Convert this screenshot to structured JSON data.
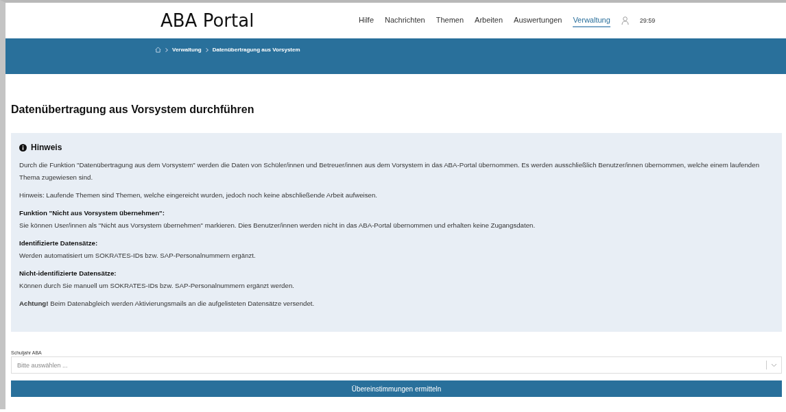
{
  "header": {
    "logo": "ABA Portal",
    "nav": [
      {
        "label": "Hilfe",
        "selected": false
      },
      {
        "label": "Nachrichten",
        "selected": false
      },
      {
        "label": "Themen",
        "selected": false
      },
      {
        "label": "Arbeiten",
        "selected": false
      },
      {
        "label": "Auswertungen",
        "selected": false
      },
      {
        "label": "Verwaltung",
        "selected": true
      }
    ],
    "session_time": "29:59"
  },
  "breadcrumb": [
    "Verwaltung",
    "Datenübertragung aus Vorsystem"
  ],
  "page_title": "Datenübertragung aus Vorsystem durchführen",
  "notice": {
    "title": "Hinweis",
    "blocks": [
      {
        "kind": "text",
        "text": "Durch die Funktion \"Datenübertragung aus dem Vorsystem\" werden die Daten von Schüler/innen und Betreuer/innen aus dem Vorsystem in das ABA-Portal übernommen. Es werden ausschließlich Benutzer/innen übernommen, welche einem laufenden Thema zugewiesen sind."
      },
      {
        "kind": "text",
        "text": "Hinweis: Laufende Themen sind Themen, welche eingereicht wurden, jedoch noch keine abschließende Arbeit aufweisen."
      },
      {
        "kind": "heading",
        "text": "Funktion \"Nicht aus Vorsystem übernehmen\":"
      },
      {
        "kind": "text",
        "text": "Sie können User/innen als \"Nicht aus Vorsystem übernehmen\" markieren. Dies Benutzer/innen werden nicht in das ABA-Portal übernommen und erhalten keine Zugangsdaten."
      },
      {
        "kind": "heading",
        "text": "Identifizierte Datensätze:"
      },
      {
        "kind": "text",
        "text": "Werden automatisiert um SOKRATES-IDs bzw. SAP-Personalnummern ergänzt."
      },
      {
        "kind": "heading",
        "text": "Nicht-identifizierte Datensätze:"
      },
      {
        "kind": "text",
        "text": "Können durch Sie manuell um SOKRATES-IDs bzw. SAP-Personalnummern ergänzt werden."
      },
      {
        "kind": "text",
        "text": "**Achtung!** Beim Datenabgleich werden Aktivierungsmails an die aufgelisteten Datensätze versendet."
      }
    ]
  },
  "school_year": {
    "label": "Schuljahr ABA",
    "placeholder": "Bitte auswählen ..."
  },
  "submit_button": "Übereinstimmungen ermitteln"
}
